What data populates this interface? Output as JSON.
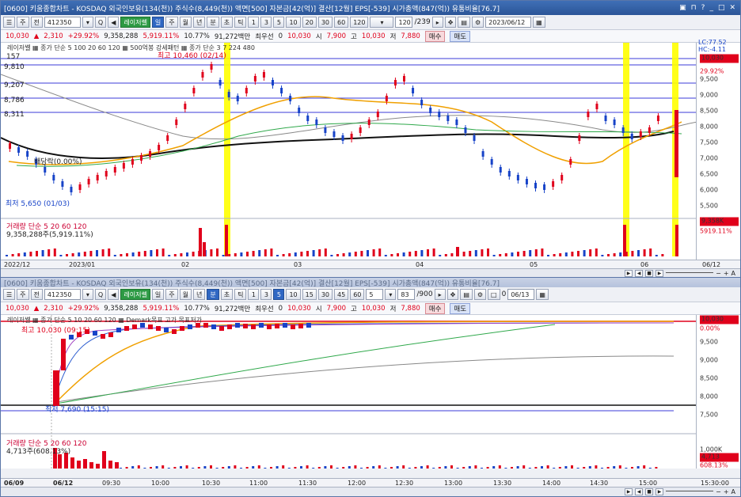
{
  "window1": {
    "title": "[0600] 키움종합차트 - KOSDAQ 외국인보유(134(천)) 주식수(8,449(천)) 액면[500] 자본금[42(억)] 결산[12월] EPS[-539] 시가총액(847(억)) 유통비율[76.7]",
    "toolbar": {
      "code_prefix": "주",
      "type": "전",
      "code": "412350",
      "search": "Q",
      "name_button": "레이저쎌",
      "periods": [
        "일",
        "주",
        "월",
        "년",
        "분",
        "초",
        "틱"
      ],
      "selected_period": "일",
      "minutes": [
        "1",
        "3",
        "5",
        "10",
        "20",
        "30",
        "60",
        "120"
      ],
      "count": "120",
      "total": "/239",
      "date": "2023/06/12"
    },
    "quote": {
      "price": "10,030",
      "change": "2,310",
      "rate": "+29.92%",
      "volume": "9,358,288",
      "vol_rate": "5,919.11%",
      "turnover": "10.77%",
      "amount": "91,272백만",
      "pref_label": "최우선",
      "pref_value": "0",
      "current": "10,030",
      "open_label": "시",
      "open": "7,900",
      "high_label": "고",
      "high": "10,030",
      "low_label": "저",
      "low": "7,880",
      "buy": "매수",
      "sell": "매도"
    },
    "legend": "레이저쎌 ▦ 종가 단순 5  100  20  60  120  ▦ 500억봉 강세패턴 ▦ 종가 단순 3  7  224  480",
    "top_right": "LC:77.52 HC:-4.11",
    "annotations": {
      "high_label": "최고 10,460 (02/14)",
      "low_label": "최저 5,650 (01/03)",
      "drop_label": "배당락(0.00%)",
      "count_label": "157"
    },
    "price_levels": [
      "9,810",
      "9,207",
      "8,786",
      "8,311"
    ],
    "price_axis": [
      "10,030",
      "9,500",
      "9,000",
      "8,500",
      "8,000",
      "7,500",
      "7,000",
      "6,500",
      "6,000",
      "5,500"
    ],
    "price_tag": "10,030",
    "price_tag_rate": "29.92%",
    "volume_legend": "거래량 단순 5  20  60  120",
    "volume_value": "9,358,288주(5,919.11%)",
    "volume_tag": "9,358K",
    "volume_tag_rate": "5919.11%",
    "x_labels": [
      "2022/12",
      "2023/01",
      "02",
      "03",
      "04",
      "05",
      "06",
      "06/12"
    ]
  },
  "window2": {
    "title": "[0600] 키움종합차트 - KOSDAQ 외국인보유(134(천)) 주식수(8,449(천)) 액면[500] 자본금[42(억)] 결산[12월] EPS[-539] 시가총액(847(억)) 유통비율[76.7]",
    "toolbar": {
      "code_prefix": "주",
      "type": "전",
      "code": "412350",
      "name_button": "레이저쎌",
      "periods": [
        "일",
        "주",
        "월",
        "년",
        "분",
        "초",
        "틱"
      ],
      "selected_period": "분",
      "minutes": [
        "1",
        "3",
        "5",
        "10",
        "15",
        "30",
        "45",
        "60"
      ],
      "selected_minute": "5",
      "interval": "5",
      "count": "83",
      "total": "/900",
      "checkbox_value": "0",
      "date": "06/13"
    },
    "quote": {
      "price": "10,030",
      "change": "2,310",
      "rate": "+29.92%",
      "volume": "9,358,288",
      "vol_rate": "5,919.11%",
      "turnover": "10.77%",
      "amount": "91,272백만",
      "pref_label": "최우선",
      "pref_value": "0",
      "current": "10,030",
      "open_label": "시",
      "open": "7,900",
      "high_label": "고",
      "high": "10,030",
      "low_label": "저",
      "low": "7,880",
      "buy": "매수",
      "sell": "매도"
    },
    "legend": "레이저쎌 ▦ 종가 단순 5  10  20  60  120 ▦ Demark목표 고가  목표저가",
    "annotations": {
      "high_label": "최고 10,030 (09:15)",
      "low_label": "최저 7,690 (15:15)"
    },
    "price_axis": [
      "10,030",
      "10,000",
      "9,500",
      "9,000",
      "8,500",
      "8,000",
      "7,500"
    ],
    "price_tag": "10,030",
    "price_tag_rate": "0.00%",
    "volume_legend": "거래량 단순 5  20  60  120",
    "volume_value": "4,713주(608.13%)",
    "volume_axis": "1,000K",
    "volume_tag": "4,713",
    "volume_tag_rate": "608.13%",
    "x_labels": [
      "06/09",
      "06/12",
      "09:30",
      "10:00",
      "10:30",
      "11:00",
      "11:30",
      "12:00",
      "12:30",
      "13:00",
      "13:30",
      "14:00",
      "14:30",
      "15:00",
      "15:30:00"
    ]
  },
  "colors": {
    "up": "#e0001b",
    "down": "#1743c8",
    "highlight": "#ffff00",
    "ma_orange": "#f0a000",
    "ma_green": "#2ea84a",
    "ma_black": "#111111"
  }
}
